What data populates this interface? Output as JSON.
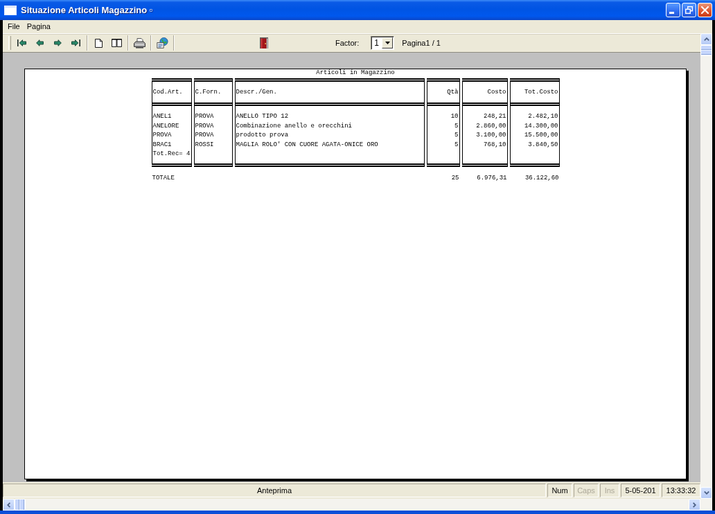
{
  "window": {
    "title": "Situazione Articoli Magazzino ▫"
  },
  "menu": [
    {
      "label": "File"
    },
    {
      "label": "Pagina"
    }
  ],
  "toolbar": {
    "factor_label": "Factor:",
    "factor": "1",
    "page_indicator": "Pagina1 / 1"
  },
  "report": {
    "title": "Articoli in Magazzino",
    "columns": [
      "Cod.Art.",
      "C.Forn.",
      "Descr./Gen.",
      "Qtà",
      "Costo",
      "Tot.Costo"
    ],
    "rows": [
      [
        "ANEL1",
        "PROVA",
        "ANELLO TIPO 12",
        "10",
        "248,21",
        "2.482,10"
      ],
      [
        "ANELORE",
        "PROVA",
        "Combinazione anello e orecchini",
        "5",
        "2.860,00",
        "14.300,00"
      ],
      [
        "PROVA",
        "PROVA",
        "prodotto prova",
        "5",
        "3.100,00",
        "15.500,00"
      ],
      [
        "BRAC1",
        "ROSSI",
        "MAGLIA ROLO' CON CUORE AGATA-ONICE ORO",
        "5",
        "768,10",
        "3.840,50"
      ]
    ],
    "record_count": "Tot.Rec= 4",
    "total": {
      "label": "TOTALE",
      "values": [
        "25",
        "6.976,31",
        "36.122,60"
      ]
    }
  },
  "status_bar": {
    "message": "Anteprima",
    "indicators": [
      {
        "label": "Num",
        "on": true
      },
      {
        "label": "Caps",
        "on": false
      },
      {
        "label": "Ins",
        "on": false
      }
    ],
    "date": "5-05-201",
    "time": "13:33:32"
  }
}
